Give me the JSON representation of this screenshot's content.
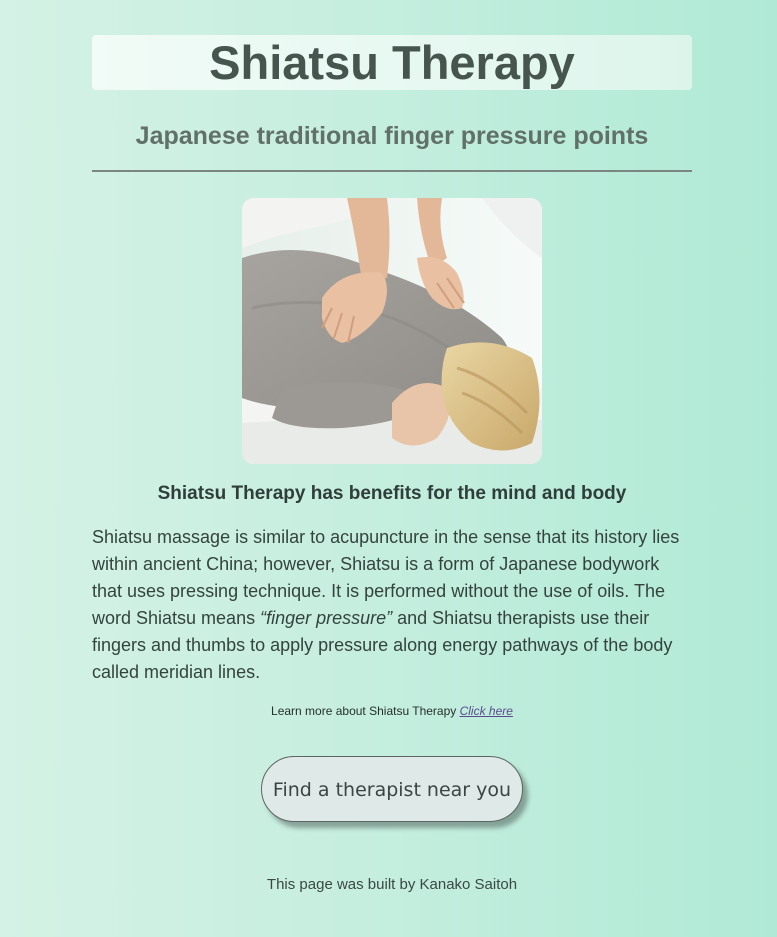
{
  "header": {
    "title": "Shiatsu Therapy",
    "subtitle": "Japanese traditional finger pressure points"
  },
  "image": {
    "description_icon": "massage-photo"
  },
  "content": {
    "heading": "Shiatsu Therapy has benefits for the mind and body",
    "paragraph_part1": "Shiatsu massage is similar to acupuncture in the sense that its history lies within ancient China; however, Shiatsu is a form of Japanese bodywork that uses pressing technique. It is performed without the use of oils. The word Shiatsu means ",
    "paragraph_emphasis": "“finger pressure”",
    "paragraph_part2": " and Shiatsu therapists use their fingers and thumbs to apply pressure along energy pathways of the body called meridian lines."
  },
  "learn_more": {
    "text": "Learn more about Shiatsu Therapy ",
    "link_label": "Click here"
  },
  "cta": {
    "label": "Find a therapist near you"
  },
  "footer": {
    "text": "This page was built by Kanako Saitoh"
  },
  "colors": {
    "background_left": "#d4f2e5",
    "background_right": "#b0ead6",
    "title": "#46564f",
    "link": "#5b4a8d"
  }
}
